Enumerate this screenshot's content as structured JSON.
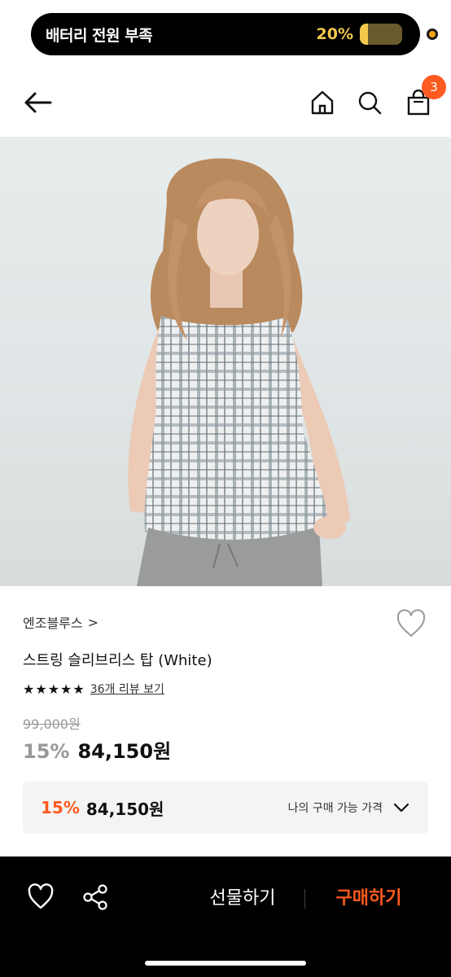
{
  "status": {
    "message": "배터리 전원 부족",
    "battery_percent": "20%",
    "battery_level": 0.2,
    "battery_color": "#f2c94c"
  },
  "header": {
    "cart_count": "3",
    "accent": "#ff5a1f"
  },
  "product": {
    "brand": "엔조블루스",
    "brand_chevron": ">",
    "name": "스트링 슬리브리스 탑 (White)",
    "stars": "★★★★★",
    "rating": 4.5,
    "review_link": "36개 리뷰 보기",
    "original_price": "99,000원",
    "discount": "15%",
    "sale_price": "84,150원"
  },
  "benefit": {
    "discount": "15%",
    "price": "84,150원",
    "label": "나의 구매 가능 가격"
  },
  "bottom": {
    "gift_label": "선물하기",
    "buy_label": "구매하기"
  }
}
